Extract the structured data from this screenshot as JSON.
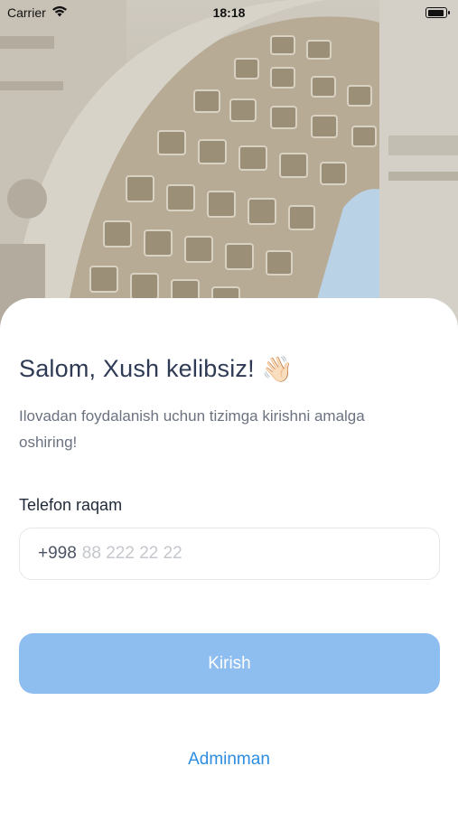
{
  "status_bar": {
    "carrier": "Carrier",
    "time": "18:18"
  },
  "hero": {
    "image": "architectural-arch-photo"
  },
  "login": {
    "title": "Salom, Xush kelibsiz!",
    "title_emoji": "👋🏻",
    "subtitle": "Ilovadan foydalanish uchun tizimga kirishni amalga oshiring!",
    "phone_label": "Telefon raqam",
    "phone_prefix": "+998",
    "phone_placeholder": "88 222 22 22",
    "phone_value": "",
    "submit_label": "Kirish",
    "admin_link": "Adminman"
  },
  "colors": {
    "primary_disabled": "#8ebdf0",
    "link": "#2d8de0",
    "title": "#2f3b55",
    "subtitle": "#6b7280"
  }
}
